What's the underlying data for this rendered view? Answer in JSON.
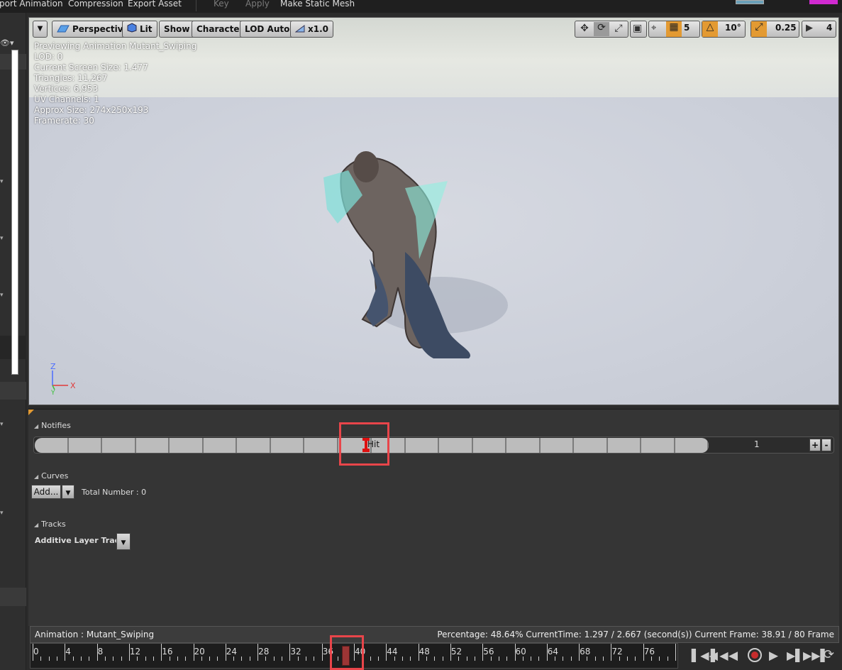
{
  "toolbar": {
    "items": [
      "port Animation",
      "Compression",
      "Export Asset",
      "Key",
      "Apply",
      "Make Static Mesh"
    ]
  },
  "viewport": {
    "buttons": {
      "perspective": "Perspective",
      "lit": "Lit",
      "show": "Show",
      "character": "Character",
      "lod": "LOD Auto",
      "speed": "x1.0",
      "grid_snap": "5",
      "rot_snap": "10°",
      "scale_snap": "0.25",
      "camera_speed": "4"
    },
    "stats": [
      "Previewing Animation Mutant_Swiping",
      "LOD: 0",
      "Current Screen Size: 1.477",
      "Triangles: 11,267",
      "Vertices: 6,953",
      "UV Channels: 1",
      "Approx Size: 274x250x193",
      "Framerate: 30"
    ],
    "axis": {
      "z": "Z",
      "y": "Y",
      "x": "X"
    },
    "colors": {
      "axis_x": "#e03a3a",
      "axis_y": "#3ac23a",
      "axis_z": "#4a6cff",
      "accent_orange": "#e39a32"
    }
  },
  "notifies": {
    "header": "Notifies",
    "track_index": "1",
    "add_label": "+",
    "remove_label": "-",
    "notify_name": "Hit"
  },
  "curves": {
    "header": "Curves",
    "add_label": "Add...",
    "total": "Total Number : 0"
  },
  "tracks": {
    "header": "Tracks",
    "additive_label": "Additive Layer Tracks"
  },
  "status": {
    "animation": "Animation :  Mutant_Swiping",
    "details": "Percentage:  48.64% CurrentTime:  1.297 / 2.667 (second(s)) Current Frame:  38.91 / 80 Frame"
  },
  "scrub": {
    "labels": [
      "0",
      "4",
      "8",
      "12",
      "16",
      "20",
      "24",
      "28",
      "32",
      "36",
      "40",
      "44",
      "48",
      "52",
      "56",
      "60",
      "64",
      "68",
      "72",
      "76"
    ],
    "total_frames": 80,
    "current_frame": 38.91
  }
}
